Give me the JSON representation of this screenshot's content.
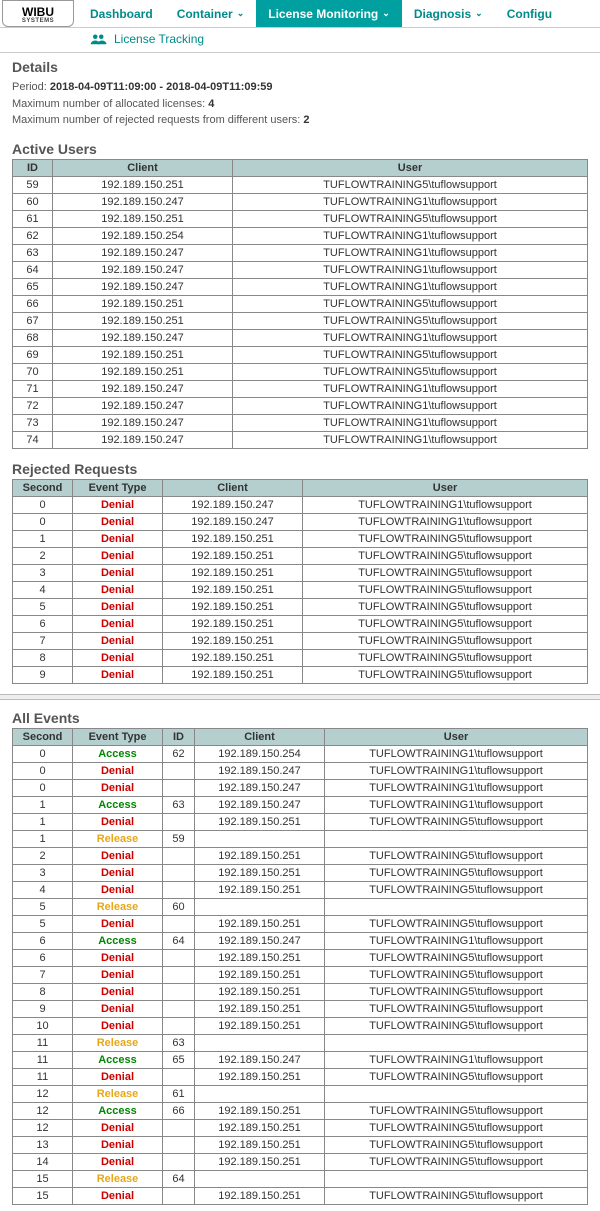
{
  "nav": {
    "logo_top": "WIBU",
    "logo_bottom": "SYSTEMS",
    "items": [
      {
        "label": "Dashboard",
        "has_caret": false,
        "active": false
      },
      {
        "label": "Container",
        "has_caret": true,
        "active": false
      },
      {
        "label": "License Monitoring",
        "has_caret": true,
        "active": true
      },
      {
        "label": "Diagnosis",
        "has_caret": true,
        "active": false
      },
      {
        "label": "Configu",
        "has_caret": false,
        "active": false
      }
    ],
    "subnav": "License Tracking"
  },
  "details": {
    "heading": "Details",
    "period_label": "Period:",
    "period_value": "2018-04-09T11:09:00 - 2018-04-09T11:09:59",
    "max_alloc_label": "Maximum number of allocated licenses:",
    "max_alloc_value": "4",
    "max_reject_label": "Maximum number of rejected requests from different users:",
    "max_reject_value": "2"
  },
  "active_users": {
    "heading": "Active Users",
    "headers": [
      "ID",
      "Client",
      "User"
    ],
    "col_widths": [
      "40px",
      "180px",
      "auto"
    ],
    "rows": [
      [
        "59",
        "192.189.150.251",
        "TUFLOWTRAINING5\\tuflowsupport"
      ],
      [
        "60",
        "192.189.150.247",
        "TUFLOWTRAINING1\\tuflowsupport"
      ],
      [
        "61",
        "192.189.150.251",
        "TUFLOWTRAINING5\\tuflowsupport"
      ],
      [
        "62",
        "192.189.150.254",
        "TUFLOWTRAINING1\\tuflowsupport"
      ],
      [
        "63",
        "192.189.150.247",
        "TUFLOWTRAINING1\\tuflowsupport"
      ],
      [
        "64",
        "192.189.150.247",
        "TUFLOWTRAINING1\\tuflowsupport"
      ],
      [
        "65",
        "192.189.150.247",
        "TUFLOWTRAINING1\\tuflowsupport"
      ],
      [
        "66",
        "192.189.150.251",
        "TUFLOWTRAINING5\\tuflowsupport"
      ],
      [
        "67",
        "192.189.150.251",
        "TUFLOWTRAINING5\\tuflowsupport"
      ],
      [
        "68",
        "192.189.150.247",
        "TUFLOWTRAINING1\\tuflowsupport"
      ],
      [
        "69",
        "192.189.150.251",
        "TUFLOWTRAINING5\\tuflowsupport"
      ],
      [
        "70",
        "192.189.150.251",
        "TUFLOWTRAINING5\\tuflowsupport"
      ],
      [
        "71",
        "192.189.150.247",
        "TUFLOWTRAINING1\\tuflowsupport"
      ],
      [
        "72",
        "192.189.150.247",
        "TUFLOWTRAINING1\\tuflowsupport"
      ],
      [
        "73",
        "192.189.150.247",
        "TUFLOWTRAINING1\\tuflowsupport"
      ],
      [
        "74",
        "192.189.150.247",
        "TUFLOWTRAINING1\\tuflowsupport"
      ]
    ]
  },
  "rejected": {
    "heading": "Rejected Requests",
    "headers": [
      "Second",
      "Event Type",
      "Client",
      "User"
    ],
    "col_widths": [
      "60px",
      "90px",
      "140px",
      "auto"
    ],
    "rows": [
      [
        "0",
        "Denial",
        "192.189.150.247",
        "TUFLOWTRAINING1\\tuflowsupport"
      ],
      [
        "0",
        "Denial",
        "192.189.150.247",
        "TUFLOWTRAINING1\\tuflowsupport"
      ],
      [
        "1",
        "Denial",
        "192.189.150.251",
        "TUFLOWTRAINING5\\tuflowsupport"
      ],
      [
        "2",
        "Denial",
        "192.189.150.251",
        "TUFLOWTRAINING5\\tuflowsupport"
      ],
      [
        "3",
        "Denial",
        "192.189.150.251",
        "TUFLOWTRAINING5\\tuflowsupport"
      ],
      [
        "4",
        "Denial",
        "192.189.150.251",
        "TUFLOWTRAINING5\\tuflowsupport"
      ],
      [
        "5",
        "Denial",
        "192.189.150.251",
        "TUFLOWTRAINING5\\tuflowsupport"
      ],
      [
        "6",
        "Denial",
        "192.189.150.251",
        "TUFLOWTRAINING5\\tuflowsupport"
      ],
      [
        "7",
        "Denial",
        "192.189.150.251",
        "TUFLOWTRAINING5\\tuflowsupport"
      ],
      [
        "8",
        "Denial",
        "192.189.150.251",
        "TUFLOWTRAINING5\\tuflowsupport"
      ],
      [
        "9",
        "Denial",
        "192.189.150.251",
        "TUFLOWTRAINING5\\tuflowsupport"
      ]
    ]
  },
  "all_events": {
    "heading": "All Events",
    "headers": [
      "Second",
      "Event Type",
      "ID",
      "Client",
      "User"
    ],
    "col_widths": [
      "60px",
      "90px",
      "32px",
      "130px",
      "auto"
    ],
    "rows": [
      [
        "0",
        "Access",
        "62",
        "192.189.150.254",
        "TUFLOWTRAINING1\\tuflowsupport"
      ],
      [
        "0",
        "Denial",
        "",
        "192.189.150.247",
        "TUFLOWTRAINING1\\tuflowsupport"
      ],
      [
        "0",
        "Denial",
        "",
        "192.189.150.247",
        "TUFLOWTRAINING1\\tuflowsupport"
      ],
      [
        "1",
        "Access",
        "63",
        "192.189.150.247",
        "TUFLOWTRAINING1\\tuflowsupport"
      ],
      [
        "1",
        "Denial",
        "",
        "192.189.150.251",
        "TUFLOWTRAINING5\\tuflowsupport"
      ],
      [
        "1",
        "Release",
        "59",
        "",
        ""
      ],
      [
        "2",
        "Denial",
        "",
        "192.189.150.251",
        "TUFLOWTRAINING5\\tuflowsupport"
      ],
      [
        "3",
        "Denial",
        "",
        "192.189.150.251",
        "TUFLOWTRAINING5\\tuflowsupport"
      ],
      [
        "4",
        "Denial",
        "",
        "192.189.150.251",
        "TUFLOWTRAINING5\\tuflowsupport"
      ],
      [
        "5",
        "Release",
        "60",
        "",
        ""
      ],
      [
        "5",
        "Denial",
        "",
        "192.189.150.251",
        "TUFLOWTRAINING5\\tuflowsupport"
      ],
      [
        "6",
        "Access",
        "64",
        "192.189.150.247",
        "TUFLOWTRAINING1\\tuflowsupport"
      ],
      [
        "6",
        "Denial",
        "",
        "192.189.150.251",
        "TUFLOWTRAINING5\\tuflowsupport"
      ],
      [
        "7",
        "Denial",
        "",
        "192.189.150.251",
        "TUFLOWTRAINING5\\tuflowsupport"
      ],
      [
        "8",
        "Denial",
        "",
        "192.189.150.251",
        "TUFLOWTRAINING5\\tuflowsupport"
      ],
      [
        "9",
        "Denial",
        "",
        "192.189.150.251",
        "TUFLOWTRAINING5\\tuflowsupport"
      ],
      [
        "10",
        "Denial",
        "",
        "192.189.150.251",
        "TUFLOWTRAINING5\\tuflowsupport"
      ],
      [
        "11",
        "Release",
        "63",
        "",
        ""
      ],
      [
        "11",
        "Access",
        "65",
        "192.189.150.247",
        "TUFLOWTRAINING1\\tuflowsupport"
      ],
      [
        "11",
        "Denial",
        "",
        "192.189.150.251",
        "TUFLOWTRAINING5\\tuflowsupport"
      ],
      [
        "12",
        "Release",
        "61",
        "",
        ""
      ],
      [
        "12",
        "Access",
        "66",
        "192.189.150.251",
        "TUFLOWTRAINING5\\tuflowsupport"
      ],
      [
        "12",
        "Denial",
        "",
        "192.189.150.251",
        "TUFLOWTRAINING5\\tuflowsupport"
      ],
      [
        "13",
        "Denial",
        "",
        "192.189.150.251",
        "TUFLOWTRAINING5\\tuflowsupport"
      ],
      [
        "14",
        "Denial",
        "",
        "192.189.150.251",
        "TUFLOWTRAINING5\\tuflowsupport"
      ],
      [
        "15",
        "Release",
        "64",
        "",
        ""
      ],
      [
        "15",
        "Denial",
        "",
        "192.189.150.251",
        "TUFLOWTRAINING5\\tuflowsupport"
      ]
    ]
  },
  "event_styles": {
    "Denial": "ev-denial",
    "Access": "ev-access",
    "Release": "ev-release"
  }
}
